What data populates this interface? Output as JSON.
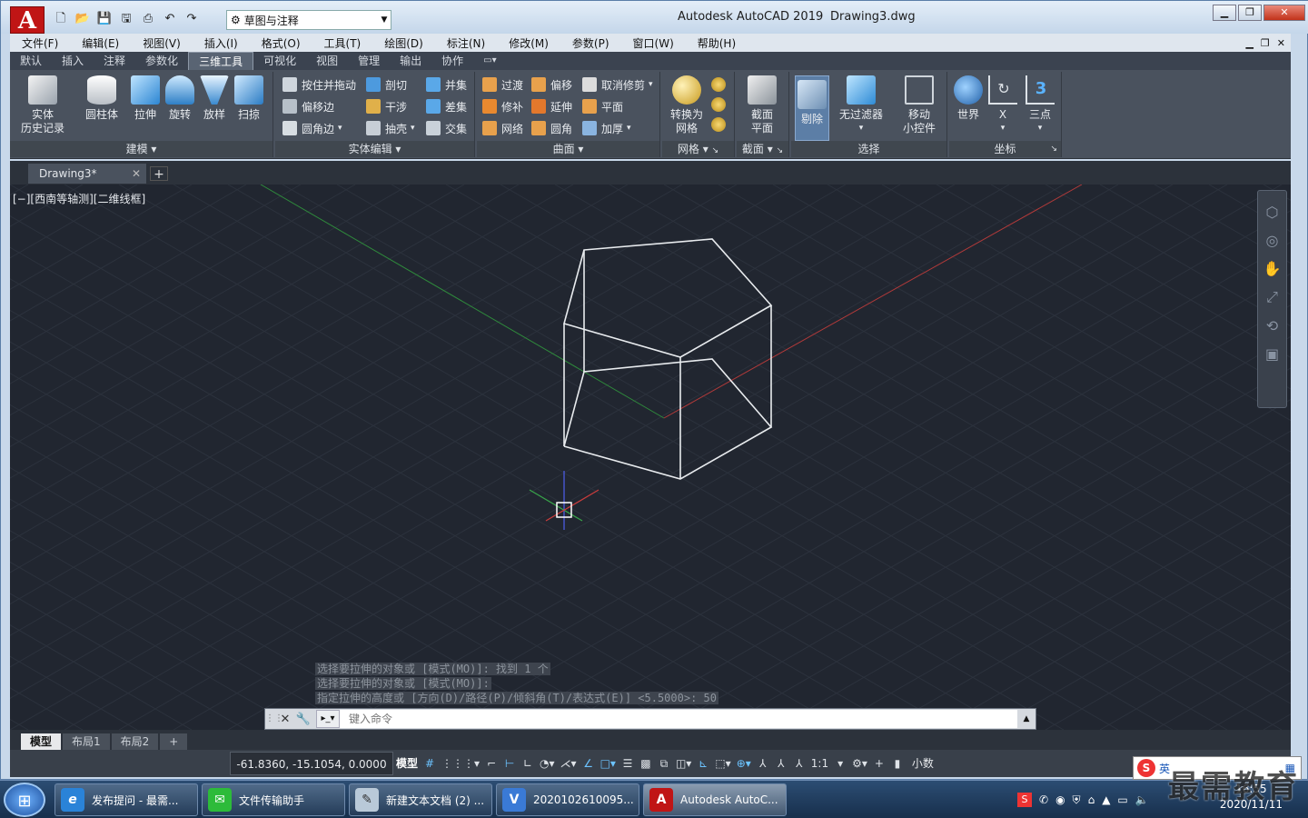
{
  "titlebar": {
    "app_title": "Autodesk AutoCAD 2019",
    "file_name": "Drawing3.dwg",
    "workspace": "草图与注释",
    "logo": "A"
  },
  "menubar": [
    "文件(F)",
    "编辑(E)",
    "视图(V)",
    "插入(I)",
    "格式(O)",
    "工具(T)",
    "绘图(D)",
    "标注(N)",
    "修改(M)",
    "参数(P)",
    "窗口(W)",
    "帮助(H)"
  ],
  "ribbon_tabs": [
    "默认",
    "插入",
    "注释",
    "参数化",
    "三维工具",
    "可视化",
    "视图",
    "管理",
    "输出",
    "协作"
  ],
  "ribbon_active_tab": "三维工具",
  "panels": {
    "modeling": {
      "title": "建模",
      "buttons": [
        "实体\n历史记录",
        "圆柱体",
        "拉伸",
        "旋转",
        "放样",
        "扫掠"
      ]
    },
    "solid_edit": {
      "title": "实体编辑",
      "buttons": [
        "按住并拖动",
        "偏移边",
        "圆角边",
        "剖切",
        "干涉",
        "抽壳",
        "并集",
        "差集",
        "交集"
      ]
    },
    "surface": {
      "title": "曲面",
      "buttons": [
        "过渡",
        "修补",
        "网络",
        "偏移",
        "延伸",
        "圆角",
        "取消修剪",
        "平面",
        "加厚"
      ]
    },
    "mesh": {
      "title": "网格",
      "buttons": [
        "转换为\n网格"
      ]
    },
    "section": {
      "title": "截面",
      "buttons": [
        "截面\n平面"
      ]
    },
    "selection": {
      "title": "选择",
      "buttons": [
        "剔除",
        "无过滤器",
        "移动\n小控件"
      ]
    },
    "coordinates": {
      "title": "坐标",
      "buttons": [
        "世界",
        "X",
        "三点"
      ]
    }
  },
  "document_tab": "Drawing3*",
  "viewport": {
    "label": "[−][西南等轴测][二维线框]",
    "colors": {
      "background": "#212630",
      "edge": "#e9ecef",
      "x_axis": "#b23a3a",
      "y_axis": "#2f8a3c"
    }
  },
  "command": {
    "history": [
      "选择要拉伸的对象或 [模式(MO)]: 找到 1 个",
      "选择要拉伸的对象或 [模式(MO)]:",
      "指定拉伸的高度或 [方向(D)/路径(P)/倾斜角(T)/表达式(E)] <5.5000>: 50"
    ],
    "placeholder": "键入命令"
  },
  "layout_tabs": [
    "模型",
    "布局1",
    "布局2"
  ],
  "status": {
    "coordinates": "-61.8360, -15.1054, 0.0000",
    "model": "模型",
    "scale": "1:1",
    "units": "小数"
  },
  "taskbar": {
    "items": [
      "发布提问 - 最需...",
      "文件传输助手",
      "新建文本文档 (2) ...",
      "2020102610095...",
      "Autodesk AutoC..."
    ],
    "active_index": 4,
    "clock_time": "16:55",
    "clock_date": "2020/11/11",
    "ime_label": "英"
  },
  "watermark": "最需教育"
}
